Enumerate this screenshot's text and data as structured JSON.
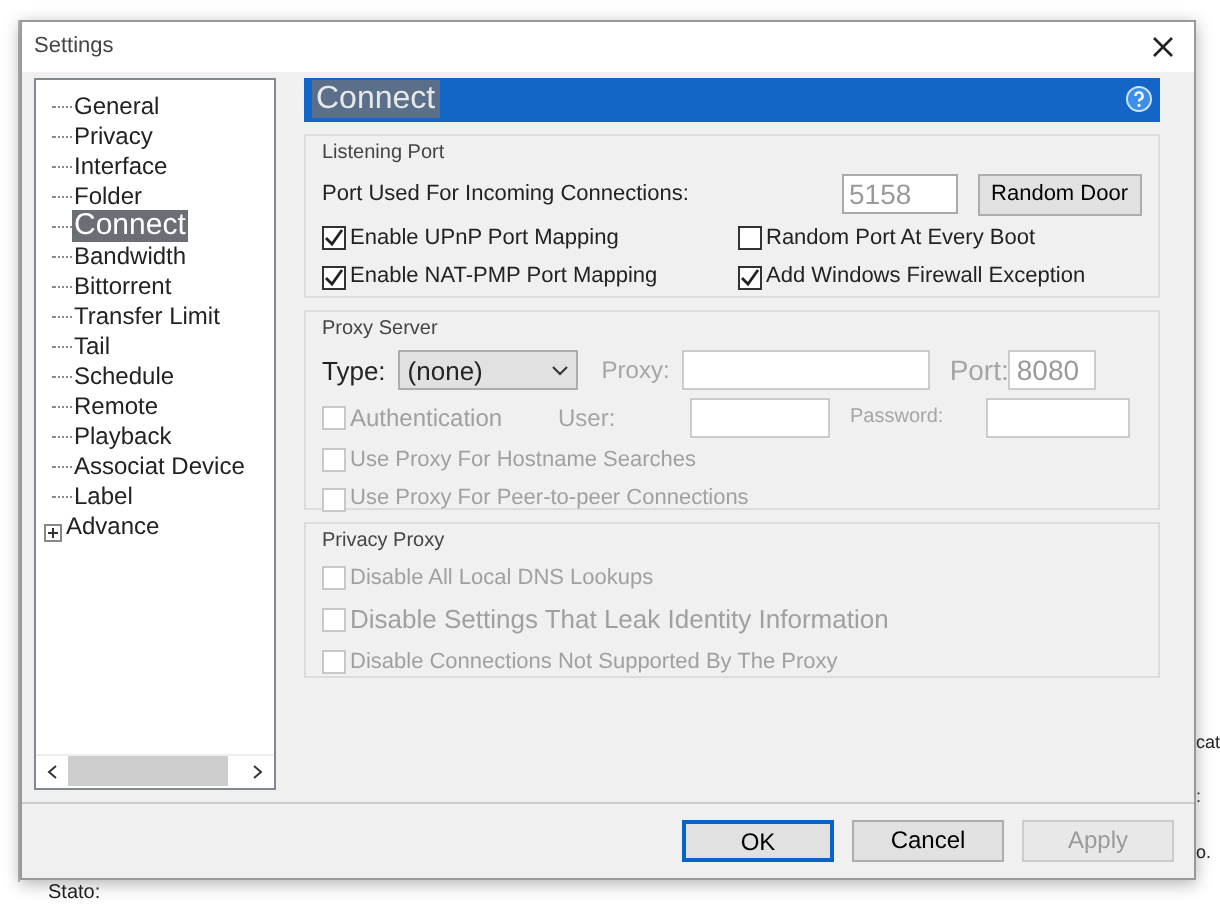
{
  "window": {
    "title": "Settings"
  },
  "tree": {
    "items": [
      {
        "label": "General",
        "selected": false
      },
      {
        "label": "Privacy",
        "selected": false
      },
      {
        "label": "Interface",
        "selected": false
      },
      {
        "label": "Folder",
        "selected": false
      },
      {
        "label": "Connect",
        "selected": true
      },
      {
        "label": "Bandwidth",
        "selected": false
      },
      {
        "label": "Bittorrent",
        "selected": false
      },
      {
        "label": "Transfer Limit",
        "selected": false
      },
      {
        "label": "Tail",
        "selected": false
      },
      {
        "label": "Schedule",
        "selected": false
      },
      {
        "label": "Remote",
        "selected": false
      },
      {
        "label": "Playback",
        "selected": false
      },
      {
        "label": "Associat Device",
        "selected": false
      },
      {
        "label": "Label",
        "selected": false
      },
      {
        "label": "Advance",
        "selected": false,
        "expanded": false
      }
    ]
  },
  "panel": {
    "title": "Connect",
    "listening_port": {
      "legend": "Listening Port",
      "port_label": "Port Used For Incoming Connections:",
      "port_value": "5158",
      "random_button": "Random Door",
      "options": [
        {
          "label": "Enable UPnP Port Mapping",
          "checked": true,
          "disabled": false
        },
        {
          "label": "Random Port At Every Boot",
          "checked": false,
          "disabled": false
        },
        {
          "label": "Enable NAT-PMP Port Mapping",
          "checked": true,
          "disabled": false
        },
        {
          "label": "Add Windows Firewall Exception",
          "checked": true,
          "disabled": false
        }
      ]
    },
    "proxy_server": {
      "legend": "Proxy Server",
      "type_label": "Type:",
      "type_value": "(none)",
      "fields_disabled": true,
      "proxy_label": "Proxy:",
      "port_label": "Port:",
      "port_value": "8080",
      "authentication": {
        "label": "Authentication",
        "checked": false,
        "disabled": true
      },
      "user_label": "User:",
      "password_label": "Password:",
      "options": [
        {
          "label": "Use Proxy For Hostname Searches",
          "checked": false,
          "disabled": true
        },
        {
          "label": "Use Proxy For Peer-to-peer Connections",
          "checked": false,
          "disabled": true
        }
      ]
    },
    "privacy_proxy": {
      "legend": "Privacy Proxy",
      "options": [
        {
          "label": "Disable All Local DNS Lookups",
          "checked": false,
          "disabled": true
        },
        {
          "label": "Disable Settings That Leak Identity Information",
          "checked": false,
          "disabled": true
        },
        {
          "label": "Disable Connections Not Supported By The Proxy",
          "checked": false,
          "disabled": true
        }
      ]
    }
  },
  "buttons": [
    {
      "label": "OK",
      "focused": true,
      "disabled": false
    },
    {
      "label": "Cancel",
      "focused": false,
      "disabled": false
    },
    {
      "label": "Apply",
      "focused": false,
      "disabled": true
    }
  ],
  "background": {
    "status_label": "Stato:",
    "fragments": [
      "cat",
      ":",
      "o."
    ]
  }
}
